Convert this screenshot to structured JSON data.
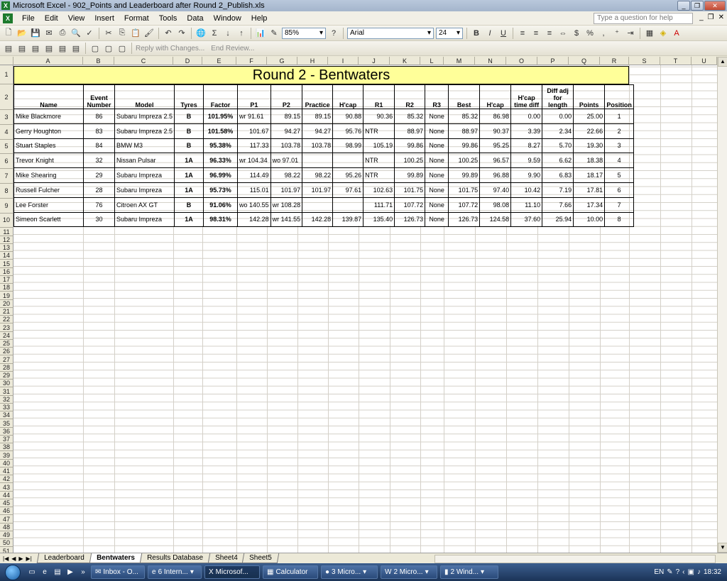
{
  "window": {
    "title": "Microsoft Excel - 902_Points and Leaderboard after Round 2_Publish.xls",
    "help_placeholder": "Type a question for help"
  },
  "menu": [
    "File",
    "Edit",
    "View",
    "Insert",
    "Format",
    "Tools",
    "Data",
    "Window",
    "Help"
  ],
  "toolbar": {
    "zoom": "85%",
    "font": "Arial",
    "font_size": "24",
    "reply": "Reply with Changes...",
    "end_review": "End Review..."
  },
  "columns": [
    "A",
    "B",
    "C",
    "D",
    "E",
    "F",
    "G",
    "H",
    "I",
    "J",
    "K",
    "L",
    "M",
    "N",
    "O",
    "P",
    "Q",
    "R",
    "S",
    "T",
    "U"
  ],
  "sheet": {
    "title": "Round 2 - Bentwaters",
    "headers": [
      "Name",
      "Event Number",
      "Model",
      "Tyres",
      "Factor",
      "P1",
      "P2",
      "Practice",
      "H'cap",
      "R1",
      "R2",
      "R3",
      "Best",
      "H'cap",
      "H'cap time diff",
      "Diff adj for length",
      "Points",
      "Position"
    ],
    "rows": [
      [
        "Mike Blackmore",
        "86",
        "Subaru Impreza 2.5",
        "B",
        "101.95%",
        "wr 91.61",
        "89.15",
        "89.15",
        "90.88",
        "90.36",
        "85.32",
        "None",
        "85.32",
        "86.98",
        "0.00",
        "0.00",
        "25.00",
        "1"
      ],
      [
        "Gerry Houghton",
        "83",
        "Subaru Impreza 2.5",
        "B",
        "101.58%",
        "101.67",
        "94.27",
        "94.27",
        "95.76",
        "NTR",
        "88.97",
        "None",
        "88.97",
        "90.37",
        "3.39",
        "2.34",
        "22.66",
        "2"
      ],
      [
        "Stuart Staples",
        "84",
        "BMW M3",
        "B",
        "95.38%",
        "117.33",
        "103.78",
        "103.78",
        "98.99",
        "105.19",
        "99.86",
        "None",
        "99.86",
        "95.25",
        "8.27",
        "5.70",
        "19.30",
        "3"
      ],
      [
        "Trevor Knight",
        "32",
        "Nissan Pulsar",
        "1A",
        "96.33%",
        "wr 104.34",
        "wo 97.01",
        "",
        "",
        "NTR",
        "100.25",
        "None",
        "100.25",
        "96.57",
        "9.59",
        "6.62",
        "18.38",
        "4"
      ],
      [
        "Mike Shearing",
        "29",
        "Subaru Impreza",
        "1A",
        "96.99%",
        "114.49",
        "98.22",
        "98.22",
        "95.26",
        "NTR",
        "99.89",
        "None",
        "99.89",
        "96.88",
        "9.90",
        "6.83",
        "18.17",
        "5"
      ],
      [
        "Russell Fulcher",
        "28",
        "Subaru Impreza",
        "1A",
        "95.73%",
        "115.01",
        "101.97",
        "101.97",
        "97.61",
        "102.63",
        "101.75",
        "None",
        "101.75",
        "97.40",
        "10.42",
        "7.19",
        "17.81",
        "6"
      ],
      [
        "Lee Forster",
        "76",
        "Citroen AX GT",
        "B",
        "91.06%",
        "wo 140.55",
        "wr 108.28",
        "",
        "",
        "111.71",
        "107.72",
        "None",
        "107.72",
        "98.08",
        "11.10",
        "7.66",
        "17.34",
        "7"
      ],
      [
        "Simeon Scarlett",
        "30",
        "Subaru Impreza",
        "1A",
        "98.31%",
        "142.28",
        "wr 141.55",
        "142.28",
        "139.87",
        "135.40",
        "126.73",
        "None",
        "126.73",
        "124.58",
        "37.60",
        "25.94",
        "10.00",
        "8"
      ]
    ]
  },
  "tabs": [
    "Leaderboard",
    "Bentwaters",
    "Results Database",
    "Sheet4",
    "Sheet5"
  ],
  "active_tab": "Bentwaters",
  "taskbar": {
    "items": [
      "Inbox - O...",
      "6 Intern...",
      "Microsof...",
      "Calculator",
      "3 Micro...",
      "2 Micro...",
      "2 Wind..."
    ],
    "lang": "EN",
    "clock": "18:32"
  }
}
